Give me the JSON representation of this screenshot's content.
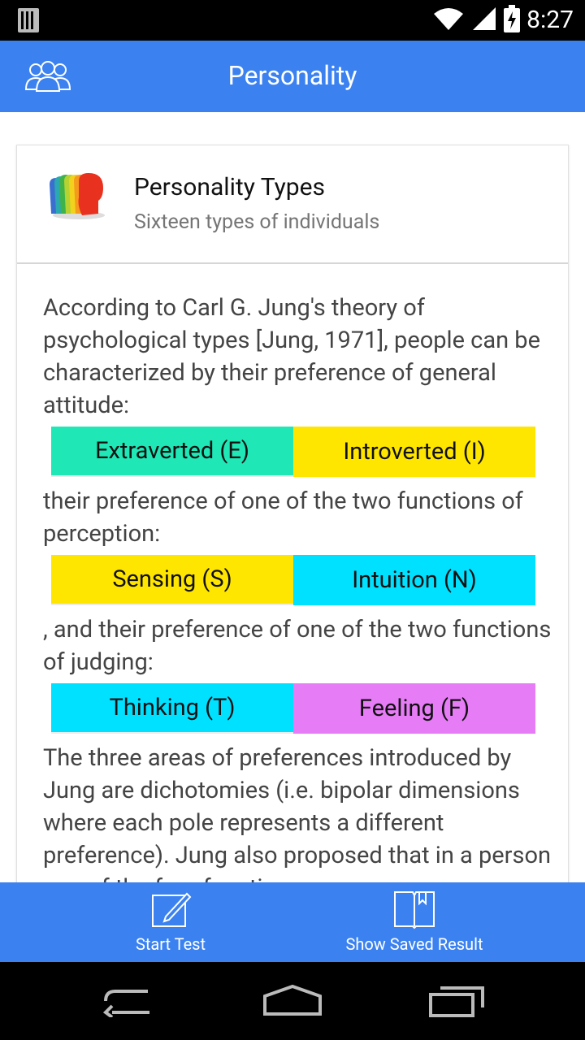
{
  "status_bar": {
    "time": "8:27"
  },
  "app_bar": {
    "title": "Personality"
  },
  "card": {
    "title": "Personality Types",
    "subtitle": "Sixteen types of individuals"
  },
  "paragraphs": {
    "p1": "According to Carl G. Jung's theory of psychological types [Jung, 1971], people can be characterized by their preference of general attitude:",
    "p2": "their preference of one of the two functions of perception:",
    "p3": ", and their preference of one of the two functions of judging:",
    "p4": "The three areas of preferences introduced by Jung are dichotomies (i.e. bipolar dimensions where each pole represents a different preference). Jung also proposed that in a person one of the four functions"
  },
  "dichotomies": [
    {
      "left": "Extraverted (E)",
      "right": "Introverted (I)"
    },
    {
      "left": "Sensing (S)",
      "right": "Intuition (N)"
    },
    {
      "left": "Thinking (T)",
      "right": "Feeling (F)"
    }
  ],
  "bottom_bar": {
    "start_test": "Start Test",
    "show_saved": "Show Saved Result"
  },
  "colors": {
    "primary": "#3b82f0",
    "extraverted": "#1fe7b6",
    "yellow": "#ffe600",
    "cyan": "#00e1ff",
    "feeling": "#e77cf7"
  }
}
